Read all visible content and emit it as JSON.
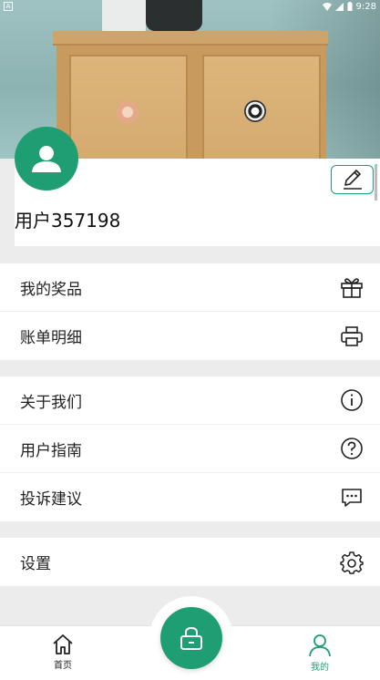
{
  "status_bar": {
    "time": "9:28",
    "left_badge": "A"
  },
  "profile": {
    "username": "用户357198"
  },
  "menu_groups": [
    {
      "items": [
        {
          "label": "我的奖品",
          "icon": "gift-icon"
        },
        {
          "label": "账单明细",
          "icon": "printer-icon"
        }
      ]
    },
    {
      "items": [
        {
          "label": "关于我们",
          "icon": "info-icon"
        },
        {
          "label": "用户指南",
          "icon": "help-icon"
        },
        {
          "label": "投诉建议",
          "icon": "chat-icon"
        }
      ]
    },
    {
      "items": [
        {
          "label": "设置",
          "icon": "gear-icon"
        }
      ]
    }
  ],
  "bottom_nav": {
    "home_label": "首页",
    "mine_label": "我的"
  },
  "colors": {
    "accent": "#1e9e72",
    "background": "#ececec"
  }
}
